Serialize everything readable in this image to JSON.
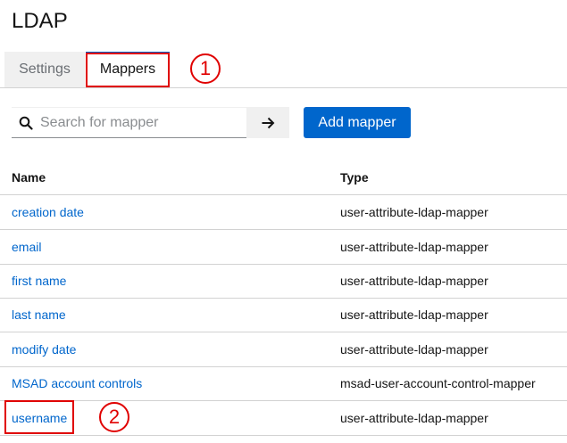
{
  "page": {
    "title": "LDAP"
  },
  "tabs": {
    "settings": "Settings",
    "mappers": "Mappers"
  },
  "annotations": {
    "marker_1": "1",
    "marker_2": "2"
  },
  "toolbar": {
    "search_placeholder": "Search for mapper",
    "add_label": "Add mapper"
  },
  "table": {
    "headers": {
      "name": "Name",
      "type": "Type"
    },
    "rows": [
      {
        "name": "creation date",
        "type": "user-attribute-ldap-mapper"
      },
      {
        "name": "email",
        "type": "user-attribute-ldap-mapper"
      },
      {
        "name": "first name",
        "type": "user-attribute-ldap-mapper"
      },
      {
        "name": "last name",
        "type": "user-attribute-ldap-mapper"
      },
      {
        "name": "modify date",
        "type": "user-attribute-ldap-mapper"
      },
      {
        "name": "MSAD account controls",
        "type": "msad-user-account-control-mapper"
      },
      {
        "name": "username",
        "type": "user-attribute-ldap-mapper"
      }
    ]
  },
  "colors": {
    "accent": "#0066cc",
    "highlight": "#e00000"
  }
}
